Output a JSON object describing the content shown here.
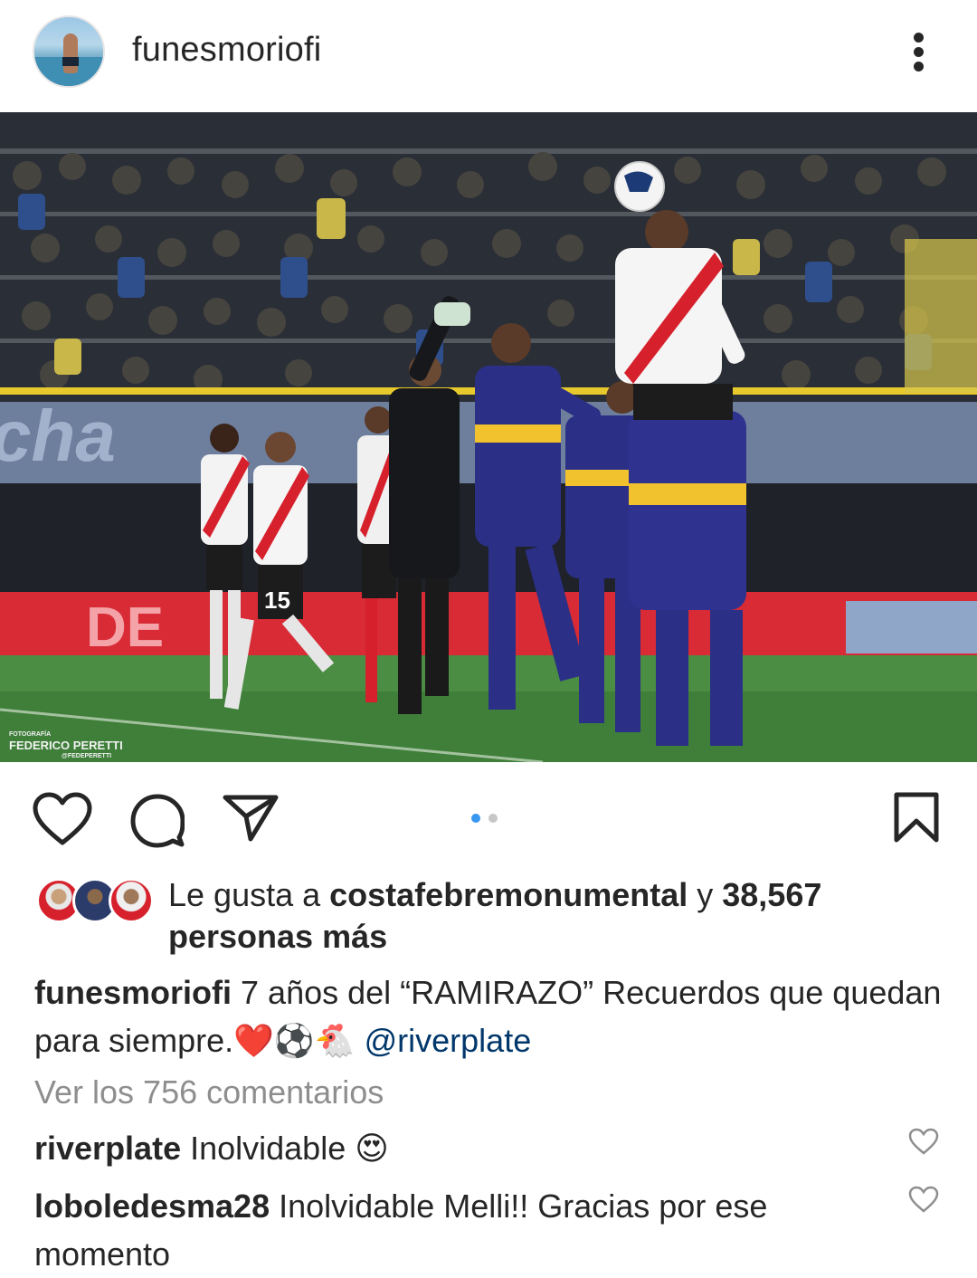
{
  "header": {
    "username": "funesmoriofi",
    "avatar_icon": "profile-avatar",
    "more_icon": "more-vertical-icon"
  },
  "photo": {
    "watermark_line1": "FOTOGRAFÍA",
    "watermark_line2": "FEDERICO PERETTI",
    "watermark_line3": "@FEDEPERETTI"
  },
  "actions": {
    "icons": [
      "heart-icon",
      "comment-icon",
      "share-icon",
      "bookmark-icon"
    ],
    "carousel_dots": 2,
    "active_dot": 0,
    "dot_active_color": "#3897f0",
    "dot_inactive_color": "#c7c7c7"
  },
  "likes": {
    "prefix": "Le gusta a ",
    "user": "costafebremonumental",
    "middle": " y ",
    "count": "38,567",
    "suffix": "personas más"
  },
  "caption": {
    "username": "funesmoriofi",
    "text": " 7 años del “RAMIRAZO” Recuerdos que quedan para siempre.",
    "emojis": "❤️⚽🐔",
    "mention": "@riverplate"
  },
  "view_comments": "Ver los 756 comentarios",
  "comments": [
    {
      "username": "riverplate",
      "text": " Inolvidable ",
      "emoji": "😍"
    },
    {
      "username": "loboledesma28",
      "text": " Inolvidable Melli!! Gracias por ese momento",
      "emoji": ""
    }
  ],
  "colors": {
    "text": "#262626",
    "muted": "#8e8e8e",
    "link": "#00376b",
    "river_red": "#d6212d",
    "boca_blue": "#2b2f86",
    "boca_yellow": "#f2c12e"
  }
}
